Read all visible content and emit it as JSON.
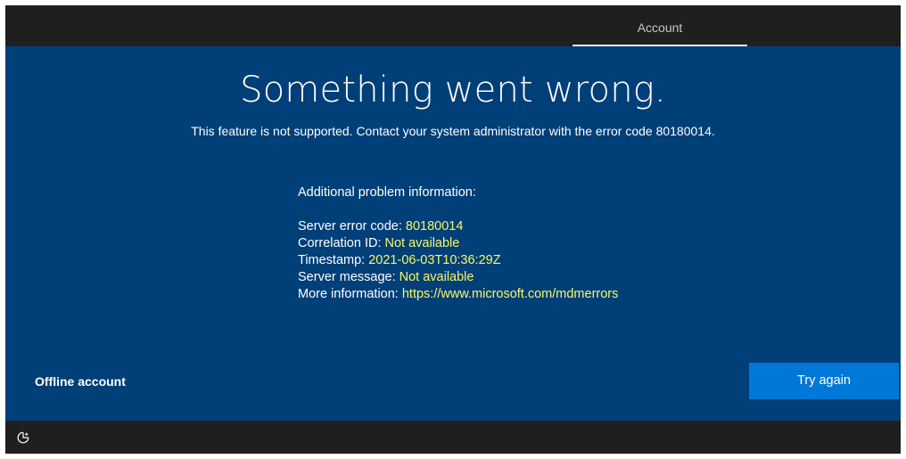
{
  "header": {
    "tab_account": "Account"
  },
  "main": {
    "title": "Something went wrong.",
    "subtitle": "This feature is not supported. Contact your system administrator with the error code 80180014.",
    "info_heading": "Additional problem information:",
    "rows": [
      {
        "label": "Server error code: ",
        "value": "80180014"
      },
      {
        "label": "Correlation ID: ",
        "value": "Not available"
      },
      {
        "label": "Timestamp: ",
        "value": "2021-06-03T10:36:29Z"
      },
      {
        "label": "Server message: ",
        "value": "Not available"
      },
      {
        "label": "More information: ",
        "value": "https://www.microsoft.com/mdmerrors"
      }
    ]
  },
  "footer": {
    "offline_account": "Offline account",
    "try_again": "Try again",
    "ease_of_access_icon": "ease-of-access-icon"
  },
  "colors": {
    "main_background": "#003f78",
    "bars": "#1f1f1f",
    "accent_button": "#0078d7",
    "value_text": "#f7f76b"
  }
}
